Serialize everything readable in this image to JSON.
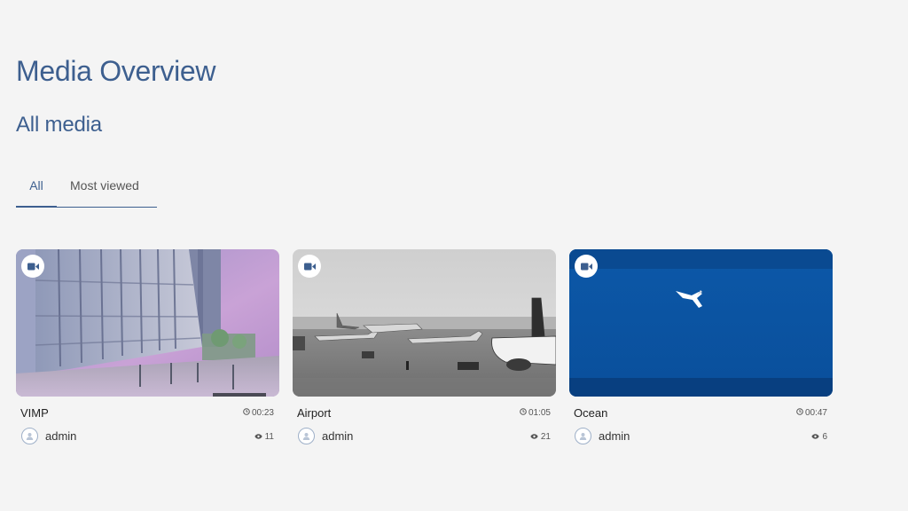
{
  "page": {
    "title": "Media Overview",
    "section_title": "All media"
  },
  "tabs": [
    {
      "label": "All",
      "active": true
    },
    {
      "label": "Most viewed",
      "active": false
    }
  ],
  "media": [
    {
      "title": "VIMP",
      "duration": "00:23",
      "author": "admin",
      "views": "11",
      "type_icon": "video-camera-icon",
      "thumbnail": "building"
    },
    {
      "title": "Airport",
      "duration": "01:05",
      "author": "admin",
      "views": "21",
      "type_icon": "video-camera-icon",
      "thumbnail": "airport"
    },
    {
      "title": "Ocean",
      "duration": "00:47",
      "author": "admin",
      "views": "6",
      "type_icon": "video-camera-icon",
      "thumbnail": "ocean"
    }
  ],
  "colors": {
    "accent": "#3d5f8f",
    "background": "#f4f4f4",
    "ocean": "#0b4f9a"
  }
}
